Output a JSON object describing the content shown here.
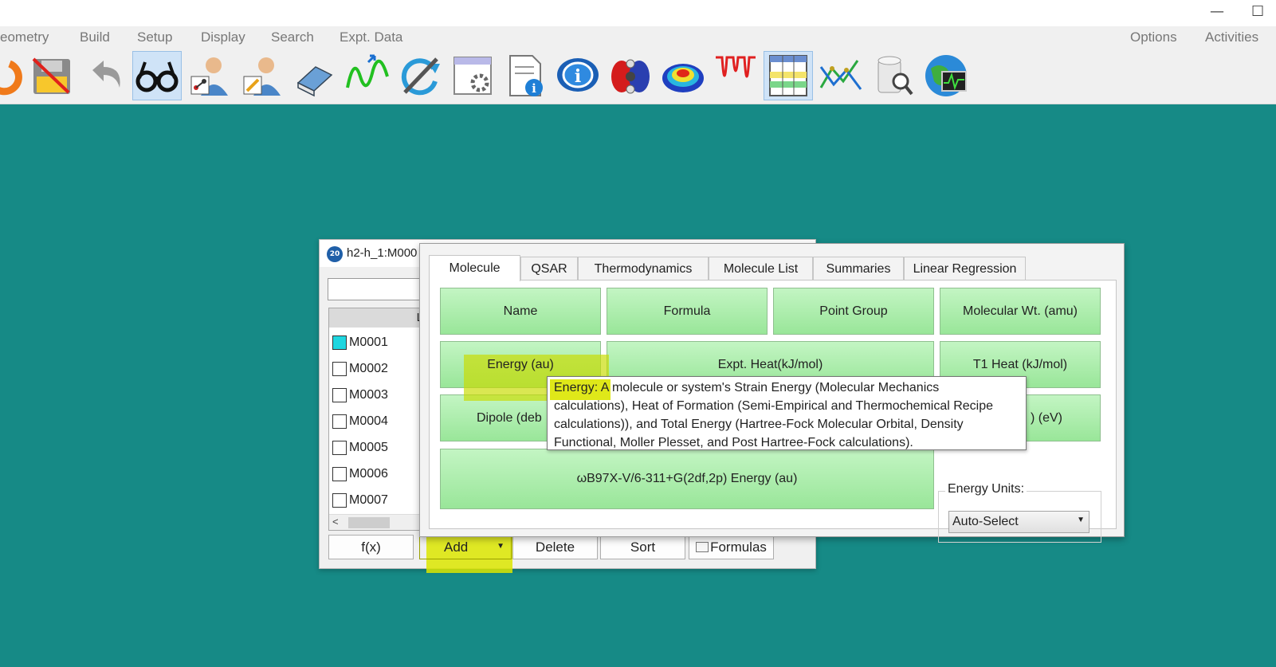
{
  "window_controls": {
    "minimize": "—",
    "maximize": "☐"
  },
  "menu": {
    "left": [
      "eometry",
      "Build",
      "Setup",
      "Display",
      "Search",
      "Expt. Data"
    ],
    "right": [
      "Options",
      "Activities"
    ]
  },
  "toolbar_icons": [
    "refresh-arrow-icon",
    "save-disabled-icon",
    "undo-icon",
    "glasses-view-icon",
    "scientist-molecule-icon",
    "scientist-edit-icon",
    "eraser-icon",
    "spectrum-wave-icon",
    "sync-arrows-icon",
    "window-settings-icon",
    "document-info-icon",
    "info-bubble-icon",
    "orbital-icon",
    "potential-surface-icon",
    "ir-spectrum-icon",
    "spreadsheet-icon",
    "plot-graph-icon",
    "database-search-icon",
    "globe-monitor-icon"
  ],
  "list_window": {
    "title": "h2-h_1:M000",
    "column_header": "L",
    "rows": [
      {
        "label": "M0001",
        "checked": true
      },
      {
        "label": "M0002",
        "checked": false
      },
      {
        "label": "M0003",
        "checked": false
      },
      {
        "label": "M0004",
        "checked": false
      },
      {
        "label": "M0005",
        "checked": false
      },
      {
        "label": "M0006",
        "checked": false
      },
      {
        "label": "M0007",
        "checked": false
      }
    ],
    "scroll_left": "<",
    "buttons": {
      "fx": "f(x)",
      "add": "Add",
      "delete": "Delete",
      "sort": "Sort",
      "formulas": "Formulas"
    }
  },
  "add_dialog": {
    "tabs": [
      "Molecule",
      "QSAR",
      "Thermodynamics",
      "Molecule List",
      "Summaries",
      "Linear Regression"
    ],
    "buttons": {
      "name": "Name",
      "formula": "Formula",
      "point_group": "Point Group",
      "mol_wt": "Molecular Wt. (amu)",
      "energy": "Energy (au)",
      "expt_heat": "Expt. Heat(kJ/mol)",
      "t1_heat": "T1 Heat (kJ/mol)",
      "dipole": "Dipole (deb",
      "ev_partial": ") (eV)",
      "wb97": "ωB97X-V/6-311+G(2df,2p) Energy (au)"
    },
    "energy_units": {
      "label": "Energy Units:",
      "value": "Auto-Select"
    }
  },
  "tooltip": {
    "lead": "Energy: A",
    "line1_rest": " molecule or system's Strain Energy (Molecular Mechanics",
    "line2": "calculations), Heat of Formation (Semi-Empirical and Thermochemical Recipe",
    "line3": "calculations)), and Total Energy (Hartree-Fock Molecular Orbital, Density",
    "line4": "Functional, Moller Plesset, and Post Hartree-Fock calculations)."
  }
}
